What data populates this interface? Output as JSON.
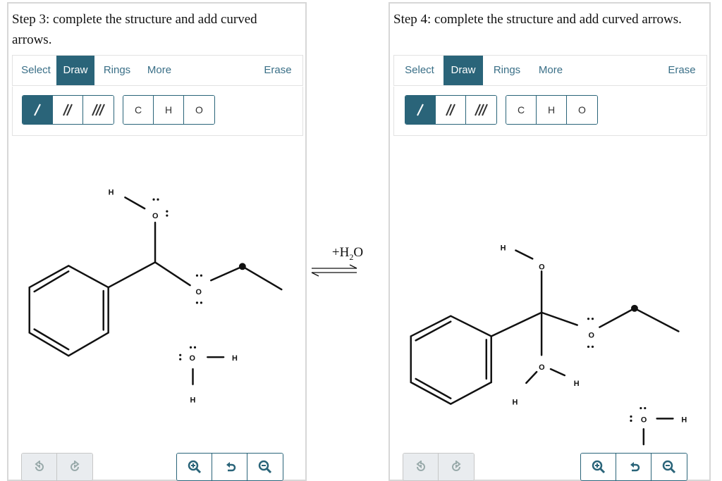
{
  "left_panel": {
    "title": "Step 3: complete the structure and add curved arrows.",
    "tabs": {
      "select": "Select",
      "draw": "Draw",
      "rings": "Rings",
      "more": "More",
      "erase": "Erase"
    },
    "atoms": [
      "C",
      "H",
      "O"
    ]
  },
  "right_panel": {
    "title": "Step 4: complete the structure and add curved arrows.",
    "tabs": {
      "select": "Select",
      "draw": "Draw",
      "rings": "Rings",
      "more": "More",
      "erase": "Erase"
    },
    "atoms": [
      "C",
      "H",
      "O"
    ]
  },
  "reagent": {
    "prefix": "+H",
    "subscript": "2",
    "suffix": "O"
  },
  "icons": {
    "bonds": [
      "single-bond-icon",
      "double-bond-icon",
      "triple-bond-icon"
    ],
    "history": [
      "undo-icon",
      "redo-icon"
    ],
    "zoom": [
      "zoom-in-icon",
      "zoom-reset-icon",
      "zoom-out-icon"
    ],
    "arrow": "equilibrium-arrow-icon"
  },
  "colors": {
    "accent": "#2a6479",
    "tab_text": "#3a6f87",
    "border": "#d7d7d7"
  },
  "molecules": {
    "left": {
      "labels": {
        "h_top": "H",
        "o_top": "O",
        "o_ether": "O",
        "o_water": "O",
        "h_water_right": "H",
        "h_water_bottom": "H"
      }
    },
    "right": {
      "labels": {
        "h_top": "H",
        "o_top": "O",
        "o_ether": "O",
        "o_mid": "O",
        "h_mid_right": "H",
        "h_mid_left": "H",
        "o_water": "O",
        "h_water_right": "H"
      }
    }
  }
}
